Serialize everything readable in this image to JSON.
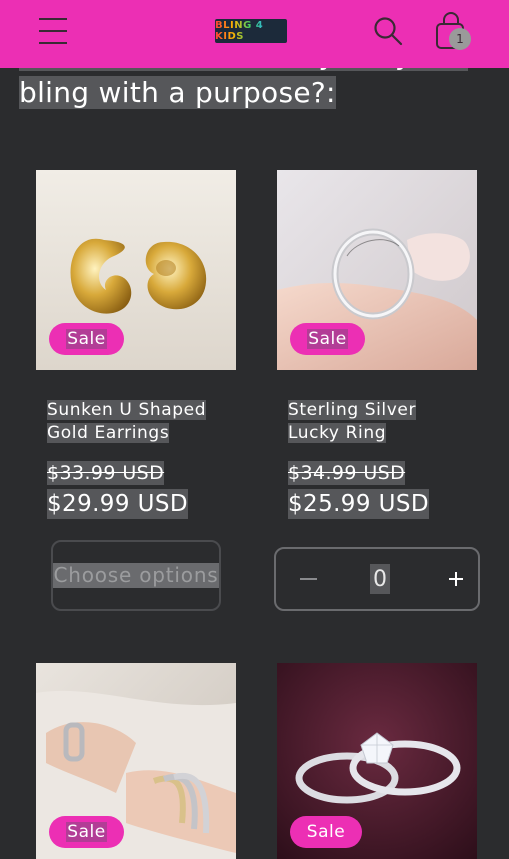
{
  "intro": {
    "text": "trafficked kid & family, why not bling with a purpose?:"
  },
  "header": {
    "logo_text": "BLING 4 KIDS",
    "cart_count": "1"
  },
  "products": [
    {
      "title": "Sunken U Shaped Gold Earrings",
      "badge": "Sale",
      "old_price": "$33.99 USD",
      "new_price": "$29.99 USD",
      "action": "Choose options"
    },
    {
      "title": "Sterling Silver Lucky Ring",
      "badge": "Sale",
      "old_price": "$34.99 USD",
      "new_price": "$25.99 USD",
      "quantity": "0"
    },
    {
      "badge": "Sale"
    },
    {
      "badge": "Sale"
    }
  ],
  "colors": {
    "header_bg": "#ec2fb4",
    "page_bg": "#2b2c2e",
    "badge_bg": "#ec2fb4"
  },
  "icons": [
    "menu-icon",
    "search-icon",
    "cart-icon",
    "minus-icon",
    "plus-icon"
  ]
}
